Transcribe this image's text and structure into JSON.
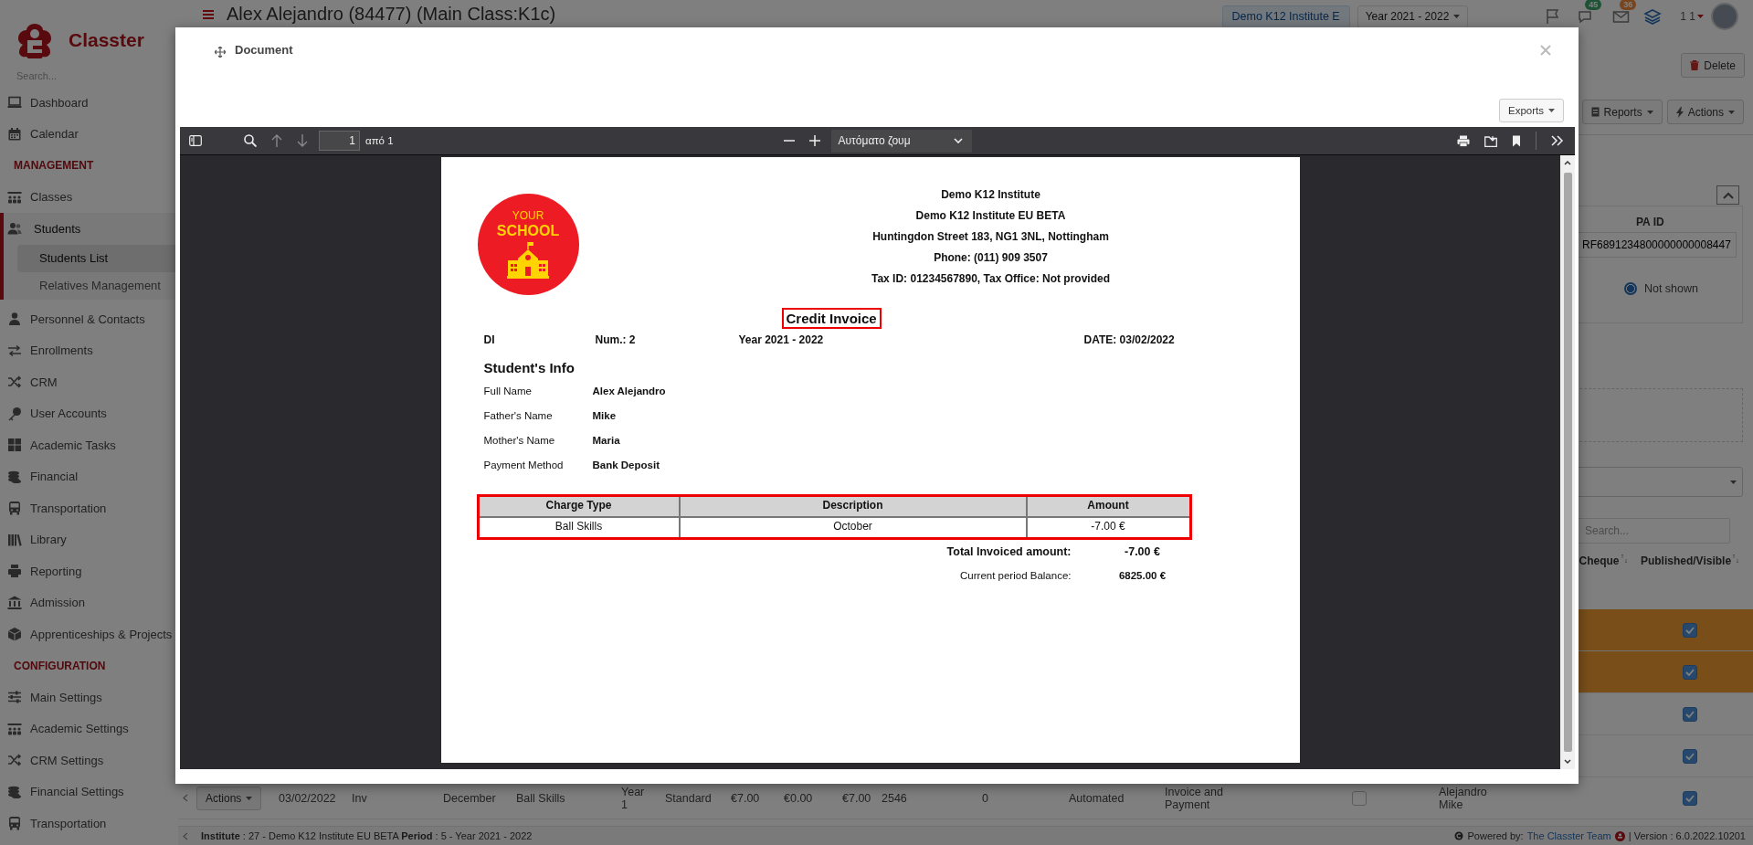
{
  "sidebar": {
    "logo_text": "Classter",
    "search_placeholder": "Search...",
    "sections": [
      {
        "items": [
          {
            "label": "Dashboard",
            "selected": false
          },
          {
            "label": "Calendar",
            "selected": false
          }
        ]
      },
      {
        "heading": "MANAGEMENT",
        "items": [
          {
            "label": "Classes",
            "selected": false
          },
          {
            "label": "Students",
            "selected": true,
            "children": [
              {
                "label": "Students List",
                "selected": true
              },
              {
                "label": "Relatives Management",
                "selected": false
              }
            ]
          },
          {
            "label": "Personnel & Contacts",
            "selected": false
          },
          {
            "label": "Enrollments",
            "selected": false
          },
          {
            "label": "CRM",
            "selected": false
          },
          {
            "label": "User Accounts",
            "selected": false
          },
          {
            "label": "Academic Tasks",
            "selected": false
          },
          {
            "label": "Financial",
            "selected": false
          },
          {
            "label": "Transportation",
            "selected": false
          },
          {
            "label": "Library",
            "selected": false
          },
          {
            "label": "Reporting",
            "selected": false
          },
          {
            "label": "Admission",
            "selected": false
          },
          {
            "label": "Apprenticeships & Projects",
            "selected": false
          }
        ]
      },
      {
        "heading": "CONFIGURATION",
        "items": [
          {
            "label": "Main Settings",
            "selected": false
          },
          {
            "label": "Academic Settings",
            "selected": false
          },
          {
            "label": "CRM Settings",
            "selected": false
          },
          {
            "label": "Financial Settings",
            "selected": false
          },
          {
            "label": "Transportation",
            "selected": false
          }
        ]
      }
    ]
  },
  "header": {
    "title": "Alex Alejandro (84477) (Main Class:K1c)",
    "institute": "Demo K12 Institute E",
    "year": "Year 2021 - 2022",
    "chat_badge": "45",
    "mail_badge": "36",
    "user_label": "1 1"
  },
  "toolbar": {
    "delete": "Delete",
    "reports": "Reports",
    "actions": "Actions"
  },
  "details": {
    "pa_id_label": "PA ID",
    "pa_id_value": "RF6891234800000000008447",
    "radio": {
      "label": "Not shown",
      "selected": true
    },
    "search_placeholder": "Search..."
  },
  "table": {
    "columns": [
      "Cheque",
      "Published/Visible"
    ],
    "rows": [
      {
        "highlighted": true,
        "published": true
      },
      {
        "highlighted": true,
        "published": true
      },
      {
        "highlighted": false,
        "published": true
      },
      {
        "highlighted": false,
        "published": true
      },
      {
        "highlighted": false,
        "published": true,
        "actions": "Actions",
        "cells": [
          "03/02/2022",
          "Inv",
          "December",
          "Ball Skills",
          "Year 1",
          "Standard",
          "€7.00",
          "€0.00",
          "€7.00",
          "2546",
          "0",
          "Automated",
          "Invoice and Payment"
        ],
        "checkbox_checked": false,
        "payer": "Alejandro Mike"
      }
    ]
  },
  "footer": {
    "info": "**Institute** : 27 - Demo K12 Institute EU BETA **Period** : 5 - Year 2021 - 2022",
    "powered": "Powered by:",
    "link": "The Classter Team",
    "version": "| Version : 6.0.2022.10201"
  },
  "modal": {
    "title": "Document",
    "exports": "Exports",
    "viewer": {
      "page": "1",
      "page_count": "από 1",
      "zoom": "Αυτόματο ζουμ"
    },
    "document": {
      "logo_top": "YOUR",
      "logo_main": "SCHOOL",
      "company_lines": [
        "Demo K12 Institute",
        "Demo K12 Institute EU BETA",
        "Huntingdon Street 183, NG1 3NL, Nottingham",
        "Phone: (011) 909 3507",
        "Tax ID: 01234567890, Tax Office: Not provided"
      ],
      "title": "Credit Invoice",
      "doc_type": "DI",
      "number": "Num.: 2",
      "year": "Year 2021 - 2022",
      "date": "DATE: 03/02/2022",
      "info_heading": "Student's Info",
      "info": [
        {
          "label": "Full Name",
          "value": "Alex Alejandro"
        },
        {
          "label": "Father's Name",
          "value": "Mike"
        },
        {
          "label": "Mother's Name",
          "value": "Maria"
        },
        {
          "label": "Payment Method",
          "value": "Bank Deposit"
        }
      ],
      "charges": {
        "columns": [
          "Charge Type",
          "Description",
          "Amount"
        ],
        "rows": [
          [
            "Ball Skills",
            "October",
            "-7.00 €"
          ]
        ]
      },
      "totals": [
        {
          "kind": "total",
          "label": "Total Invoiced amount:",
          "value": "-7.00 €"
        },
        {
          "kind": "balance",
          "label": "Current period Balance:",
          "value": "6825.00 €"
        }
      ]
    }
  }
}
